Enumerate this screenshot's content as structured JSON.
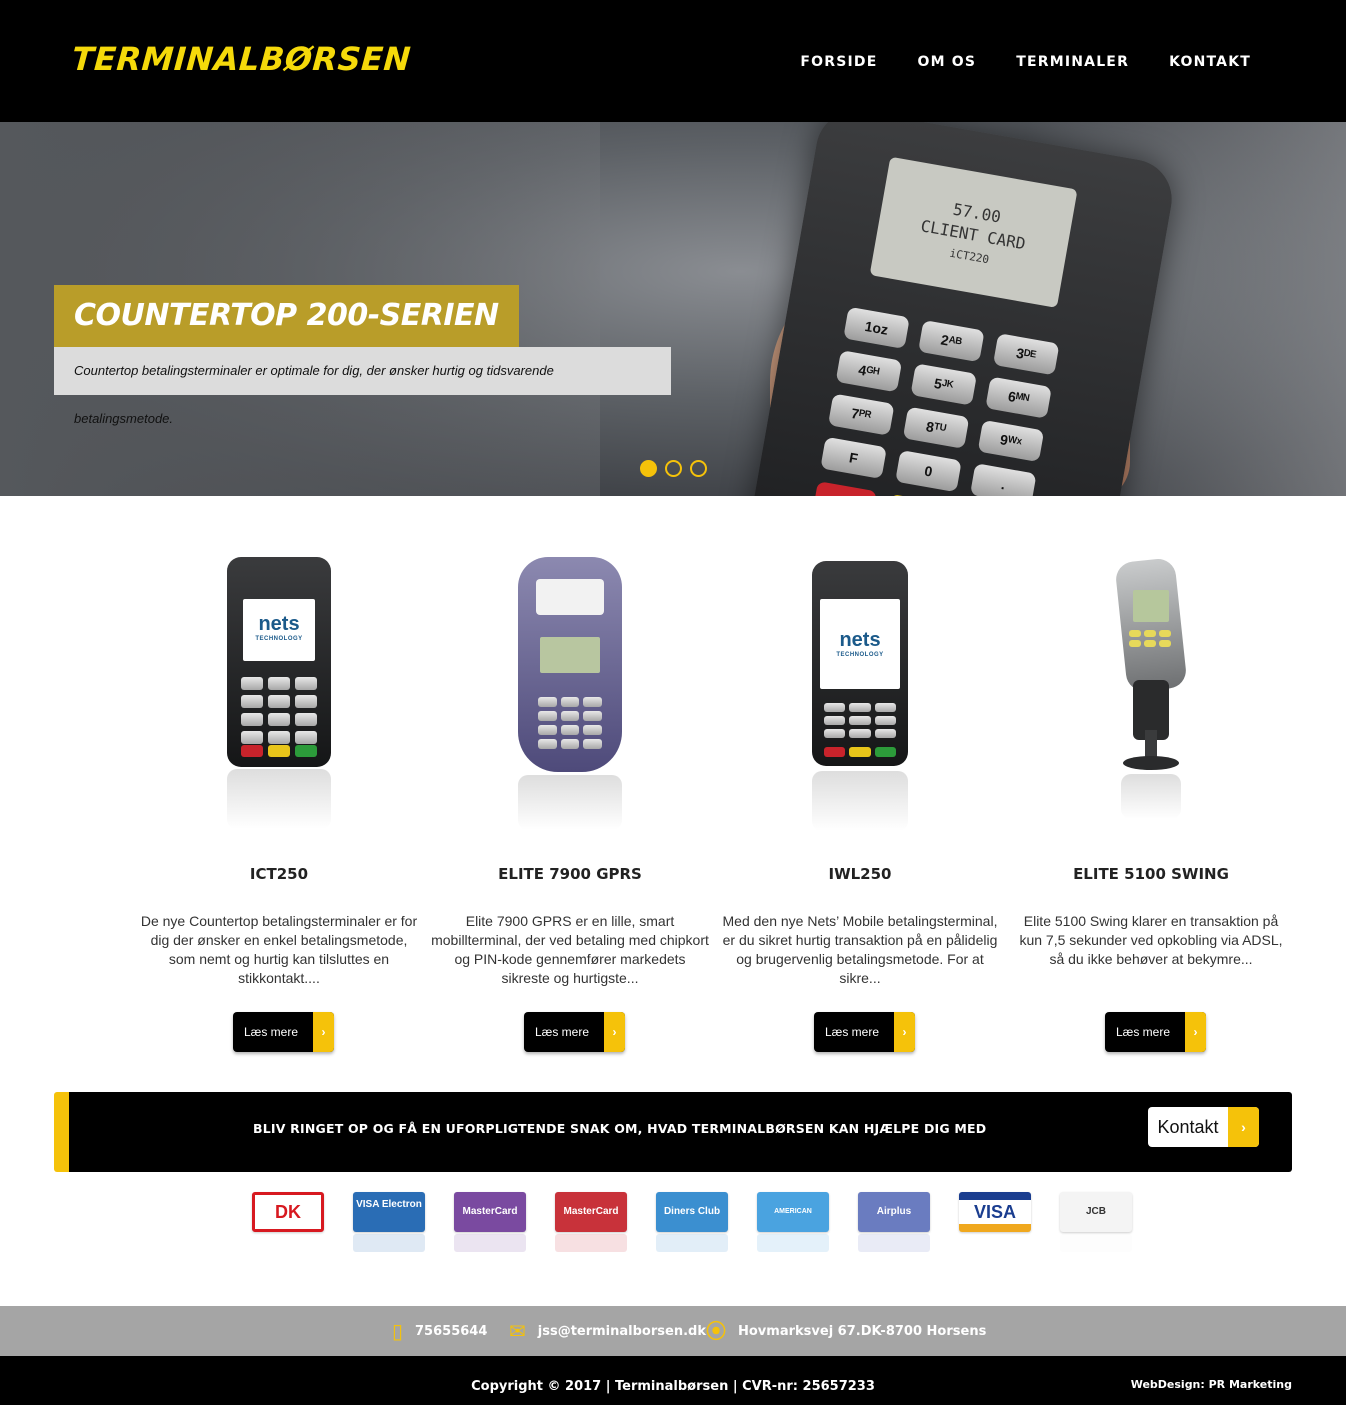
{
  "header": {
    "logo": "TERMINALBØRSEN",
    "nav": [
      "FORSIDE",
      "OM OS",
      "TERMINALER",
      "KONTAKT"
    ]
  },
  "hero": {
    "title": "COUNTERTOP 200-SERIEN",
    "subtitle": "Countertop betalingsterminaler er optimale for dig, der ønsker hurtig og tidsvarende betalingsmetode.",
    "terminal_screen": [
      "57.00",
      "CLIENT CARD",
      "iCT220"
    ],
    "keys": [
      "1oz",
      "2ᴬᴮ",
      "3ᴰᴱ",
      "4ᴳᴴ",
      "5ᴶᴷ",
      "6ᴹᴺ",
      "7ᴾᴿ",
      "8ᵀᵁ",
      "9ᵂˣ",
      "F",
      "0",
      "."
    ],
    "active_slide": 1,
    "slide_count": 3
  },
  "products": [
    {
      "name": "ICT250",
      "desc": "De nye Countertop betalingsterminaler er for dig der ønsker en enkel betalingsmetode, som nemt og hurtig kan tilsluttes en stikkontakt....",
      "button": "Læs mere"
    },
    {
      "name": "ELITE 7900 GPRS",
      "desc": "Elite 7900 GPRS er en lille, smart mobillterminal, der ved betaling med chipkort og PIN-kode gennemfører markedets sikreste og hurtigste...",
      "button": "Læs mere"
    },
    {
      "name": "IWL250",
      "desc": "Med den nye Nets’ Mobile betalingsterminal, er du sikret hurtig transaktion på en pålidelig og brugervenlig betalingsmetode. For at sikre...",
      "button": "Læs mere"
    },
    {
      "name": "ELITE 5100 SWING",
      "desc": "Elite 5100 Swing klarer en transaktion på kun 7,5 sekunder ved opkobling via ADSL, så du ikke behøver at bekymre...",
      "button": "Læs mere"
    }
  ],
  "screen_logo": {
    "brand": "nets",
    "tag": "TECHNOLOGY"
  },
  "cta": {
    "text": "BLIV RINGET OP OG FÅ EN UFORPLIGTENDE SNAK OM, HVAD TERMINALBØRSEN KAN HJÆLPE DIG MED",
    "button": "Kontakt"
  },
  "cards": [
    {
      "label": "DK",
      "color": "#d71920"
    },
    {
      "label": "VISA Electron",
      "color": "#2a6db5"
    },
    {
      "label": "MasterCard",
      "color": "#7a4aa0"
    },
    {
      "label": "MasterCard",
      "color": "#c8323a"
    },
    {
      "label": "Diners Club",
      "color": "#3b8fd0"
    },
    {
      "label": "AMERICAN EXPRESS",
      "color": "#4aa3e0"
    },
    {
      "label": "Airplus",
      "color": "#6a7cc0"
    },
    {
      "label": "VISA",
      "color": "#1a3d8f"
    },
    {
      "label": "JCB",
      "color": "#e8e8e8"
    }
  ],
  "contact": {
    "phone": "75655644",
    "email": "jss@terminalborsen.dk",
    "address": "Hovmarksvej 67.DK-8700 Horsens"
  },
  "footer": {
    "copyright": "Copyright © 2017 | Terminalbørsen | CVR-nr: 25657233",
    "webdesign": "WebDesign: PR Marketing"
  },
  "colors": {
    "accent": "#f5c20a",
    "gold": "#b99d29",
    "black": "#000000"
  }
}
